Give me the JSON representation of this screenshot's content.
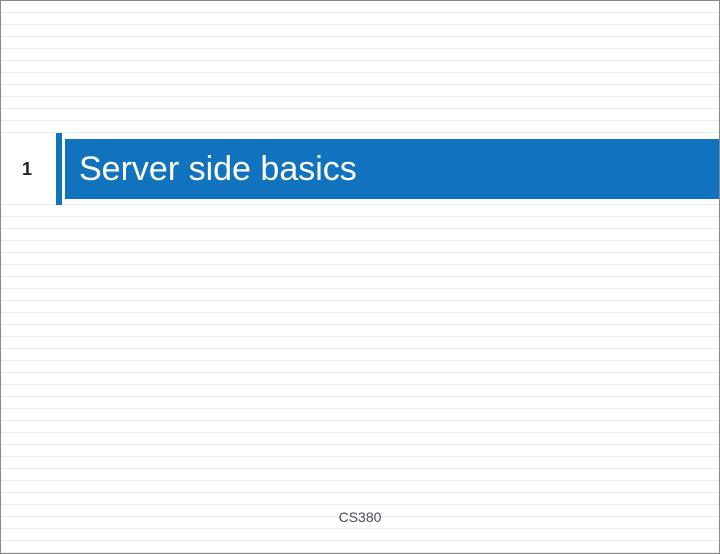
{
  "slide": {
    "page_number": "1",
    "title": "Server side basics",
    "footer": "CS380"
  }
}
